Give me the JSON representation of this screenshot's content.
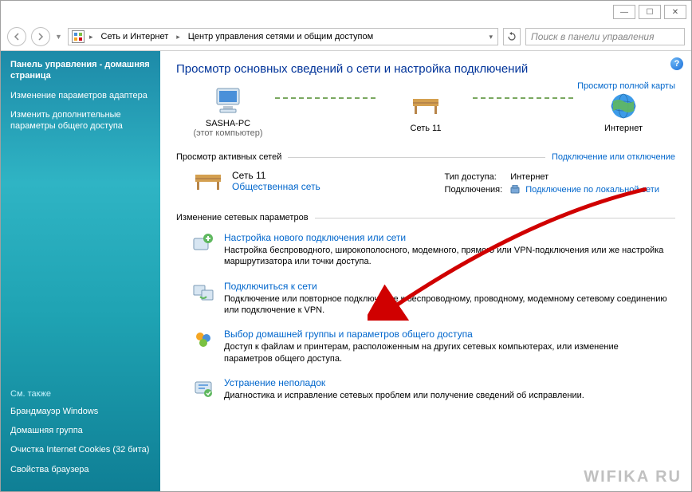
{
  "titlebar": {
    "minimize": "—",
    "maximize": "☐",
    "close": "✕"
  },
  "addrbar": {
    "crumb1": "Сеть и Интернет",
    "crumb2": "Центр управления сетями и общим доступом",
    "search_placeholder": "Поиск в панели управления"
  },
  "sidebar": {
    "title": "Панель управления - домашняя страница",
    "links": [
      "Изменение параметров адаптера",
      "Изменить дополнительные параметры общего доступа"
    ],
    "seealso_label": "См. также",
    "seealso": [
      "Брандмауэр Windows",
      "Домашняя группа",
      "Очистка Internet Cookies (32 бита)",
      "Свойства браузера"
    ]
  },
  "main": {
    "title": "Просмотр основных сведений о сети и настройка подключений",
    "map_link": "Просмотр полной карты",
    "nodes": {
      "pc_name": "SASHA-PC",
      "pc_sub": "(этот компьютер)",
      "net_name": "Сеть 11",
      "internet": "Интернет"
    },
    "active_header": "Просмотр активных сетей",
    "active_link": "Подключение или отключение",
    "active": {
      "name": "Сеть  11",
      "type": "Общественная сеть",
      "access_label": "Тип доступа:",
      "access_value": "Интернет",
      "conn_label": "Подключения:",
      "conn_value": "Подключение по локальной сети"
    },
    "params_header": "Изменение сетевых параметров",
    "items": [
      {
        "title": "Настройка нового подключения или сети",
        "desc": "Настройка беспроводного, широкополосного, модемного, прямого или VPN-подключения или же настройка маршрутизатора или точки доступа."
      },
      {
        "title": "Подключиться к сети",
        "desc": "Подключение или повторное подключение к беспроводному, проводному, модемному сетевому соединению или подключение к VPN."
      },
      {
        "title": "Выбор домашней группы и параметров общего доступа",
        "desc": "Доступ к файлам и принтерам, расположенным на других сетевых компьютерах, или изменение параметров общего доступа."
      },
      {
        "title": "Устранение неполадок",
        "desc": "Диагностика и исправление сетевых проблем или получение сведений об исправлении."
      }
    ]
  },
  "watermark": "WIFIKA RU"
}
